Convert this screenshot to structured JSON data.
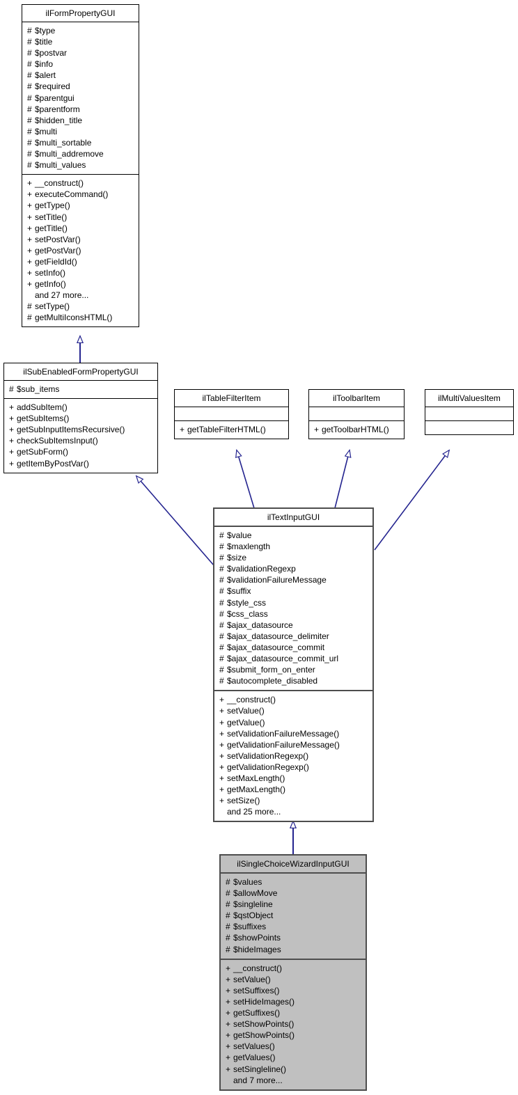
{
  "diagram": {
    "type": "uml-class-inheritance",
    "title": "ilSingleChoiceWizardInputGUI inheritance diagram",
    "line_color": "#24248f",
    "highlight_fill": "#c0c0c0",
    "box_fill": "#ffffff",
    "border_color": "#000000"
  },
  "classes": [
    {
      "id": "ilFormPropertyGUI",
      "name": "ilFormPropertyGUI",
      "highlight": false,
      "attributes": [
        {
          "sig": "#",
          "label": "$type"
        },
        {
          "sig": "#",
          "label": "$title"
        },
        {
          "sig": "#",
          "label": "$postvar"
        },
        {
          "sig": "#",
          "label": "$info"
        },
        {
          "sig": "#",
          "label": "$alert"
        },
        {
          "sig": "#",
          "label": "$required"
        },
        {
          "sig": "#",
          "label": "$parentgui"
        },
        {
          "sig": "#",
          "label": "$parentform"
        },
        {
          "sig": "#",
          "label": "$hidden_title"
        },
        {
          "sig": "#",
          "label": "$multi"
        },
        {
          "sig": "#",
          "label": "$multi_sortable"
        },
        {
          "sig": "#",
          "label": "$multi_addremove"
        },
        {
          "sig": "#",
          "label": "$multi_values"
        }
      ],
      "methods": [
        {
          "sig": "+",
          "label": "__construct()"
        },
        {
          "sig": "+",
          "label": "executeCommand()"
        },
        {
          "sig": "+",
          "label": "getType()"
        },
        {
          "sig": "+",
          "label": "setTitle()"
        },
        {
          "sig": "+",
          "label": "getTitle()"
        },
        {
          "sig": "+",
          "label": "setPostVar()"
        },
        {
          "sig": "+",
          "label": "getPostVar()"
        },
        {
          "sig": "+",
          "label": "getFieldId()"
        },
        {
          "sig": "+",
          "label": "setInfo()"
        },
        {
          "sig": "+",
          "label": "getInfo()"
        },
        {
          "sig": "",
          "label": "and 27 more..."
        },
        {
          "sig": "#",
          "label": "setType()"
        },
        {
          "sig": "#",
          "label": "getMultiIconsHTML()"
        }
      ]
    },
    {
      "id": "ilSubEnabledFormPropertyGUI",
      "name": "ilSubEnabledFormPropertyGUI",
      "highlight": false,
      "attributes": [
        {
          "sig": "#",
          "label": "$sub_items"
        }
      ],
      "methods": [
        {
          "sig": "+",
          "label": "addSubItem()"
        },
        {
          "sig": "+",
          "label": "getSubItems()"
        },
        {
          "sig": "+",
          "label": "getSubInputItemsRecursive()"
        },
        {
          "sig": "+",
          "label": "checkSubItemsInput()"
        },
        {
          "sig": "+",
          "label": "getSubForm()"
        },
        {
          "sig": "+",
          "label": "getItemByPostVar()"
        }
      ]
    },
    {
      "id": "ilTableFilterItem",
      "name": "ilTableFilterItem",
      "highlight": false,
      "attributes": [],
      "methods": [
        {
          "sig": "+",
          "label": "getTableFilterHTML()"
        }
      ]
    },
    {
      "id": "ilToolbarItem",
      "name": "ilToolbarItem",
      "highlight": false,
      "attributes": [],
      "methods": [
        {
          "sig": "+",
          "label": "getToolbarHTML()"
        }
      ]
    },
    {
      "id": "ilMultiValuesItem",
      "name": "ilMultiValuesItem",
      "highlight": false,
      "attributes": [],
      "methods": []
    },
    {
      "id": "ilTextInputGUI",
      "name": "ilTextInputGUI",
      "highlight": false,
      "attributes": [
        {
          "sig": "#",
          "label": "$value"
        },
        {
          "sig": "#",
          "label": "$maxlength"
        },
        {
          "sig": "#",
          "label": "$size"
        },
        {
          "sig": "#",
          "label": "$validationRegexp"
        },
        {
          "sig": "#",
          "label": "$validationFailureMessage"
        },
        {
          "sig": "#",
          "label": "$suffix"
        },
        {
          "sig": "#",
          "label": "$style_css"
        },
        {
          "sig": "#",
          "label": "$css_class"
        },
        {
          "sig": "#",
          "label": "$ajax_datasource"
        },
        {
          "sig": "#",
          "label": "$ajax_datasource_delimiter"
        },
        {
          "sig": "#",
          "label": "$ajax_datasource_commit"
        },
        {
          "sig": "#",
          "label": "$ajax_datasource_commit_url"
        },
        {
          "sig": "#",
          "label": "$submit_form_on_enter"
        },
        {
          "sig": "#",
          "label": "$autocomplete_disabled"
        }
      ],
      "methods": [
        {
          "sig": "+",
          "label": "__construct()"
        },
        {
          "sig": "+",
          "label": "setValue()"
        },
        {
          "sig": "+",
          "label": "getValue()"
        },
        {
          "sig": "+",
          "label": "setValidationFailureMessage()"
        },
        {
          "sig": "+",
          "label": "getValidationFailureMessage()"
        },
        {
          "sig": "+",
          "label": "setValidationRegexp()"
        },
        {
          "sig": "+",
          "label": "getValidationRegexp()"
        },
        {
          "sig": "+",
          "label": "setMaxLength()"
        },
        {
          "sig": "+",
          "label": "getMaxLength()"
        },
        {
          "sig": "+",
          "label": "setSize()"
        },
        {
          "sig": "",
          "label": "and 25 more..."
        }
      ]
    },
    {
      "id": "ilSingleChoiceWizardInputGUI",
      "name": "ilSingleChoiceWizardInputGUI",
      "highlight": true,
      "attributes": [
        {
          "sig": "#",
          "label": "$values"
        },
        {
          "sig": "#",
          "label": "$allowMove"
        },
        {
          "sig": "#",
          "label": "$singleline"
        },
        {
          "sig": "#",
          "label": "$qstObject"
        },
        {
          "sig": "#",
          "label": "$suffixes"
        },
        {
          "sig": "#",
          "label": "$showPoints"
        },
        {
          "sig": "#",
          "label": "$hideImages"
        }
      ],
      "methods": [
        {
          "sig": "+",
          "label": "__construct()"
        },
        {
          "sig": "+",
          "label": "setValue()"
        },
        {
          "sig": "+",
          "label": "setSuffixes()"
        },
        {
          "sig": "+",
          "label": "setHideImages()"
        },
        {
          "sig": "+",
          "label": "getSuffixes()"
        },
        {
          "sig": "+",
          "label": "setShowPoints()"
        },
        {
          "sig": "+",
          "label": "getShowPoints()"
        },
        {
          "sig": "+",
          "label": "setValues()"
        },
        {
          "sig": "+",
          "label": "getValues()"
        },
        {
          "sig": "+",
          "label": "setSingleline()"
        },
        {
          "sig": "",
          "label": "and 7 more..."
        }
      ]
    }
  ],
  "edges": [
    {
      "from": "ilSubEnabledFormPropertyGUI",
      "to": "ilFormPropertyGUI",
      "kind": "generalization"
    },
    {
      "from": "ilTextInputGUI",
      "to": "ilSubEnabledFormPropertyGUI",
      "kind": "generalization"
    },
    {
      "from": "ilTextInputGUI",
      "to": "ilTableFilterItem",
      "kind": "generalization"
    },
    {
      "from": "ilTextInputGUI",
      "to": "ilToolbarItem",
      "kind": "generalization"
    },
    {
      "from": "ilTextInputGUI",
      "to": "ilMultiValuesItem",
      "kind": "generalization"
    },
    {
      "from": "ilSingleChoiceWizardInputGUI",
      "to": "ilTextInputGUI",
      "kind": "generalization"
    }
  ]
}
